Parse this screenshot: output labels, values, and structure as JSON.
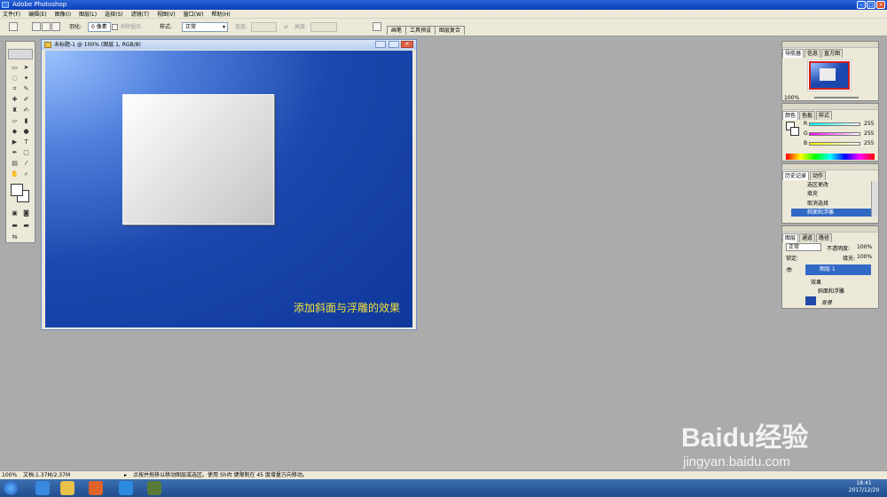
{
  "app": {
    "title": "Adobe Photoshop"
  },
  "menu": [
    "文件(F)",
    "编辑(E)",
    "图像(I)",
    "图层(L)",
    "选择(S)",
    "滤镜(T)",
    "视图(V)",
    "窗口(W)",
    "帮助(H)"
  ],
  "options": {
    "feather_label": "羽化:",
    "feather_value": "0 像素",
    "antialias_label": "消除锯齿",
    "style_label": "样式:",
    "style_value": "正常",
    "width_label": "宽度:",
    "height_label": "高度:",
    "tabs": [
      "画笔",
      "工具预设",
      "图层复合"
    ]
  },
  "document": {
    "title": "未标题-1 @ 100% (图层 1, RGB/8)",
    "caption": "添加斜面与浮雕的效果"
  },
  "navigator": {
    "tabs": [
      "导航器",
      "信息",
      "直方图"
    ],
    "zoom": "100%"
  },
  "color": {
    "tabs": [
      "颜色",
      "色板",
      "样式"
    ],
    "channels": [
      {
        "label": "R",
        "value": "255"
      },
      {
        "label": "G",
        "value": "255"
      },
      {
        "label": "B",
        "value": "255"
      }
    ]
  },
  "history": {
    "tabs": [
      "历史记录",
      "动作"
    ],
    "items": [
      "选区更改",
      "填充",
      "取消选择",
      "斜面和浮雕"
    ]
  },
  "layers": {
    "tabs": [
      "图层",
      "通道",
      "路径"
    ],
    "blend_mode": "正常",
    "opacity_label": "不透明度:",
    "opacity": "100%",
    "lock_label": "锁定:",
    "fill_label": "填充:",
    "fill": "100%",
    "rows": {
      "layer1": "图层 1",
      "effects": "效果",
      "bevel": "斜面和浮雕",
      "background": "背景"
    }
  },
  "status": {
    "zoom": "100%",
    "doc": "文档:1.37M/2.37M",
    "hint": "点按并拖移以移动图层或选区。使用 Shift 键限制在 45 度增量方向移动。"
  },
  "taskbar": {
    "time": "18:41",
    "date": "2017/12/20"
  },
  "watermark": {
    "brand": "Baidu经验",
    "url": "jingyan.baidu.com"
  }
}
